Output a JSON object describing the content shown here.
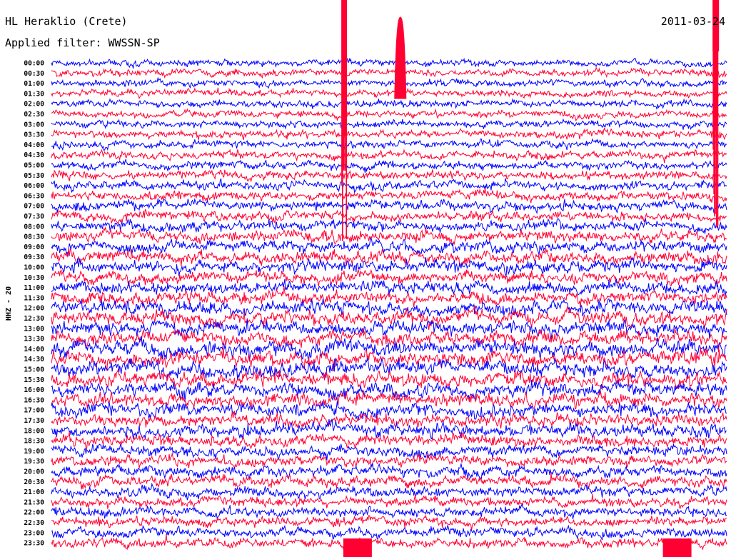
{
  "header": {
    "station": "HL Heraklio (Crete)",
    "date": "2011-03-24",
    "filter": "Applied filter: WWSSN-SP"
  },
  "chart_data": {
    "type": "helicorder",
    "channel_label": "HHZ - 20",
    "row_labels": [
      "00:00",
      "00:30",
      "01:00",
      "01:30",
      "02:00",
      "02:30",
      "03:00",
      "03:30",
      "04:00",
      "04:30",
      "05:00",
      "05:30",
      "06:00",
      "06:30",
      "07:00",
      "07:30",
      "08:00",
      "08:30",
      "09:00",
      "09:30",
      "10:00",
      "10:30",
      "11:00",
      "11:30",
      "12:00",
      "12:30",
      "13:00",
      "13:30",
      "14:00",
      "14:30",
      "15:00",
      "15:30",
      "16:00",
      "16:30",
      "17:00",
      "17:30",
      "18:00",
      "18:30",
      "19:00",
      "19:30",
      "20:00",
      "20:30",
      "21:00",
      "21:30",
      "22:00",
      "22:30",
      "23:00",
      "23:30"
    ],
    "trace_colors": [
      "#0000ff",
      "#ff0033"
    ],
    "row_activity": [
      0.5,
      0.5,
      0.5,
      0.5,
      0.5,
      0.5,
      0.5,
      0.55,
      0.55,
      0.6,
      0.6,
      0.65,
      0.65,
      0.65,
      0.7,
      0.7,
      0.75,
      0.8,
      0.85,
      0.9,
      0.9,
      0.9,
      0.9,
      0.9,
      1.0,
      1.0,
      1.0,
      1.05,
      1.1,
      1.15,
      1.1,
      1.1,
      1.0,
      1.0,
      0.95,
      0.9,
      0.9,
      0.85,
      0.8,
      0.8,
      0.8,
      0.75,
      0.75,
      0.7,
      0.7,
      0.7,
      0.7,
      0.7
    ],
    "transients": [
      {
        "row": 0,
        "minute": 13.0,
        "kind": "spike"
      },
      {
        "row": 0,
        "minute": 15.5,
        "kind": "arch"
      },
      {
        "row": 0,
        "minute": 29.5,
        "kind": "spike"
      },
      {
        "row": 47,
        "minute": 13.6,
        "kind": "blob"
      },
      {
        "row": 47,
        "minute": 27.8,
        "kind": "blob"
      }
    ]
  }
}
